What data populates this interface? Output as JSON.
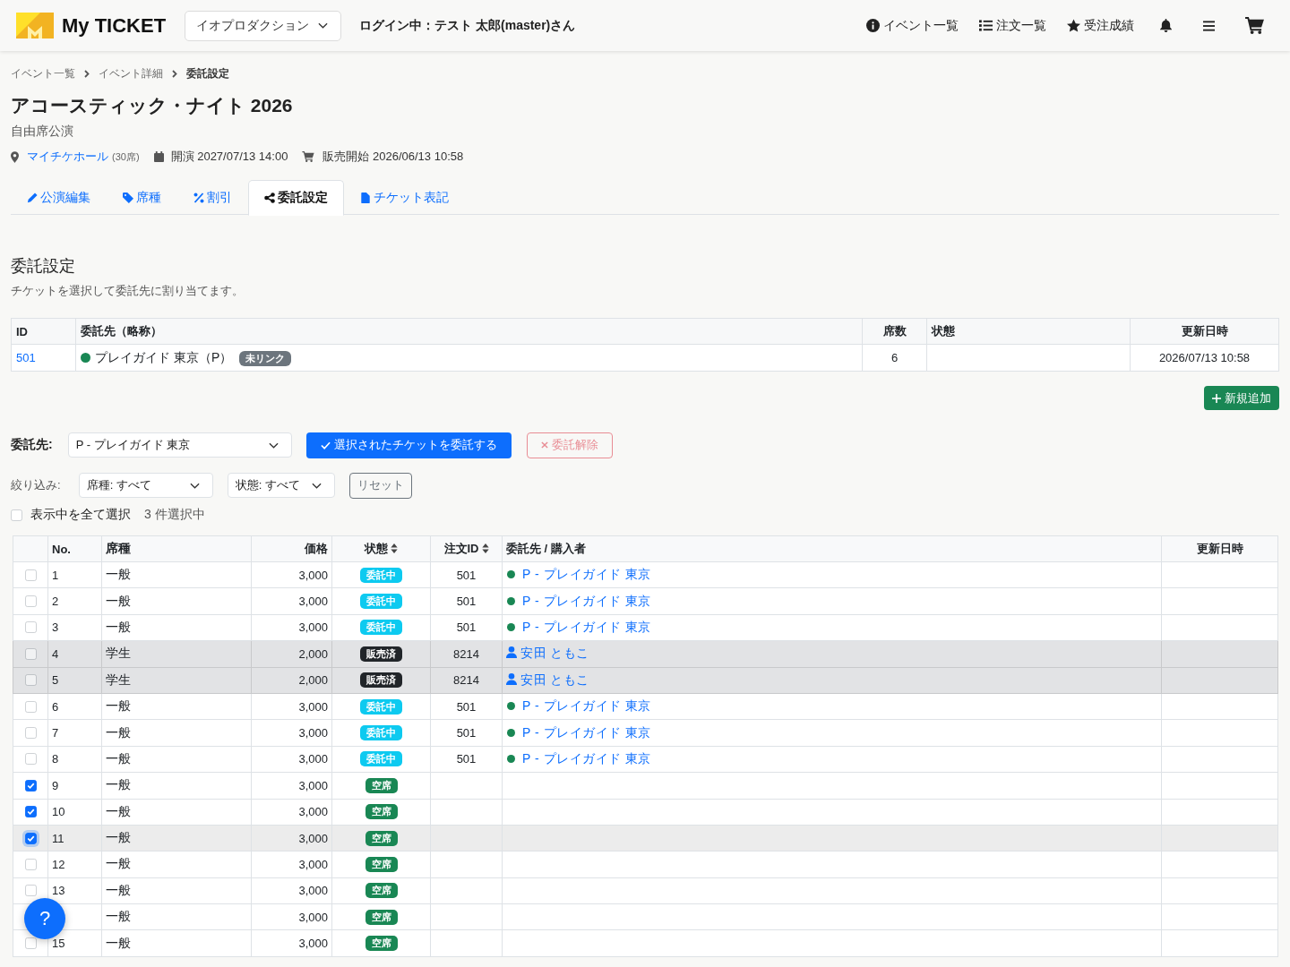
{
  "header": {
    "logo": "My TICKET",
    "company_select": {
      "value": "イオプロダクション"
    },
    "login_text": "ログイン中：テスト 太郎(master)さん",
    "nav": [
      {
        "label": "イベント一覧",
        "kind": "info"
      },
      {
        "label": "注文一覧",
        "kind": "list"
      },
      {
        "label": "受注成績",
        "kind": "star"
      }
    ]
  },
  "breadcrumb": [
    {
      "label": "イベント一覧",
      "current": false
    },
    {
      "label": "イベント詳細",
      "current": false
    },
    {
      "label": "委託設定",
      "current": true
    }
  ],
  "event": {
    "title": "アコースティック・ナイト 2026",
    "subtitle": "自由席公演",
    "venue": "マイチケホール",
    "capacity": "(30席)",
    "start": "開演 2027/07/13 14:00",
    "sale_start": "販売開始 2026/06/13 10:58"
  },
  "tabs": [
    {
      "label": "公演編集",
      "kind": "edit",
      "selected": false
    },
    {
      "label": "席種",
      "kind": "seat",
      "selected": false
    },
    {
      "label": "割引",
      "kind": "discount",
      "selected": false
    },
    {
      "label": "委託設定",
      "kind": "consign",
      "selected": true
    },
    {
      "label": "チケット表記",
      "kind": "ticket",
      "selected": false
    }
  ],
  "section": {
    "title": "委託設定",
    "description": "チケットを選択して委託先に割り当てます。"
  },
  "agencies_table": {
    "columns": [
      "ID",
      "委託先（略称）",
      "席数",
      "状態",
      "更新日時"
    ],
    "rows": [
      {
        "id": "501",
        "name": "プレイガイド 東京（P）",
        "color": "#198754",
        "badge": "未リンク",
        "seats": "6",
        "updated": "2026/07/13 10:58"
      }
    ]
  },
  "add_button": "新規追加",
  "assign_bar": {
    "label": "委託先:",
    "select": {
      "value": "P - プレイガイド 東京"
    },
    "assign_button": {
      "label": "選択されたチケットを委託する",
      "disabled": false
    },
    "release_button": {
      "label": "委託解除",
      "disabled": true
    }
  },
  "filters": {
    "label": "絞り込み:",
    "selects": [
      {
        "value": "席種: すべて"
      },
      {
        "value": "状態: すべて"
      }
    ],
    "reset_button": "リセット"
  },
  "select_all": {
    "label": "表示中を全て選択",
    "checked": false,
    "count": "3 件選択中"
  },
  "tickets_table": {
    "columns": [
      {
        "label": "No.",
        "sortable": false
      },
      {
        "label": "席種",
        "sortable": false
      },
      {
        "label": "価格",
        "sortable": false
      },
      {
        "label": "状態",
        "sortable": true
      },
      {
        "label": "注文ID",
        "sortable": true
      },
      {
        "label": "委託先 / 購入者",
        "sortable": false
      },
      {
        "label": "更新日時",
        "sortable": false
      }
    ],
    "rows": [
      {
        "no": "1",
        "seat": "一般",
        "price": "3,000",
        "status": {
          "label": "委託中",
          "kind": "consigned"
        },
        "order_id": "501",
        "assignee": {
          "kind": "agency",
          "name": "P - プレイガイド 東京",
          "color": "#198754"
        },
        "checked": false,
        "disabled": false,
        "focused": false
      },
      {
        "no": "2",
        "seat": "一般",
        "price": "3,000",
        "status": {
          "label": "委託中",
          "kind": "consigned"
        },
        "order_id": "501",
        "assignee": {
          "kind": "agency",
          "name": "P - プレイガイド 東京",
          "color": "#198754"
        },
        "checked": false,
        "disabled": false,
        "focused": false
      },
      {
        "no": "3",
        "seat": "一般",
        "price": "3,000",
        "status": {
          "label": "委託中",
          "kind": "consigned"
        },
        "order_id": "501",
        "assignee": {
          "kind": "agency",
          "name": "P - プレイガイド 東京",
          "color": "#198754"
        },
        "checked": false,
        "disabled": false,
        "focused": false
      },
      {
        "no": "4",
        "seat": "学生",
        "price": "2,000",
        "status": {
          "label": "販売済",
          "kind": "sold"
        },
        "order_id": "8214",
        "assignee": {
          "kind": "buyer",
          "name": "安田 ともこ"
        },
        "checked": false,
        "disabled": true,
        "focused": false
      },
      {
        "no": "5",
        "seat": "学生",
        "price": "2,000",
        "status": {
          "label": "販売済",
          "kind": "sold"
        },
        "order_id": "8214",
        "assignee": {
          "kind": "buyer",
          "name": "安田 ともこ"
        },
        "checked": false,
        "disabled": true,
        "focused": false
      },
      {
        "no": "6",
        "seat": "一般",
        "price": "3,000",
        "status": {
          "label": "委託中",
          "kind": "consigned"
        },
        "order_id": "501",
        "assignee": {
          "kind": "agency",
          "name": "P - プレイガイド 東京",
          "color": "#198754"
        },
        "checked": false,
        "disabled": false,
        "focused": false
      },
      {
        "no": "7",
        "seat": "一般",
        "price": "3,000",
        "status": {
          "label": "委託中",
          "kind": "consigned"
        },
        "order_id": "501",
        "assignee": {
          "kind": "agency",
          "name": "P - プレイガイド 東京",
          "color": "#198754"
        },
        "checked": false,
        "disabled": false,
        "focused": false
      },
      {
        "no": "8",
        "seat": "一般",
        "price": "3,000",
        "status": {
          "label": "委託中",
          "kind": "consigned"
        },
        "order_id": "501",
        "assignee": {
          "kind": "agency",
          "name": "P - プレイガイド 東京",
          "color": "#198754"
        },
        "checked": false,
        "disabled": false,
        "focused": false
      },
      {
        "no": "9",
        "seat": "一般",
        "price": "3,000",
        "status": {
          "label": "空席",
          "kind": "vacant"
        },
        "checked": true,
        "disabled": false,
        "focused": false
      },
      {
        "no": "10",
        "seat": "一般",
        "price": "3,000",
        "status": {
          "label": "空席",
          "kind": "vacant"
        },
        "checked": true,
        "disabled": false,
        "focused": false
      },
      {
        "no": "11",
        "seat": "一般",
        "price": "3,000",
        "status": {
          "label": "空席",
          "kind": "vacant"
        },
        "checked": true,
        "disabled": false,
        "focused": true
      },
      {
        "no": "12",
        "seat": "一般",
        "price": "3,000",
        "status": {
          "label": "空席",
          "kind": "vacant"
        },
        "checked": false,
        "disabled": false,
        "focused": false
      },
      {
        "no": "13",
        "seat": "一般",
        "price": "3,000",
        "status": {
          "label": "空席",
          "kind": "vacant"
        },
        "checked": false,
        "disabled": false,
        "focused": false
      },
      {
        "seat": "一般",
        "price": "3,000",
        "status": {
          "label": "空席",
          "kind": "vacant"
        },
        "disabled": false,
        "focused": false
      },
      {
        "no": "15",
        "seat": "一般",
        "price": "3,000",
        "status": {
          "label": "空席",
          "kind": "vacant"
        },
        "checked": false,
        "disabled": false,
        "focused": false
      }
    ]
  },
  "help_button": "?"
}
